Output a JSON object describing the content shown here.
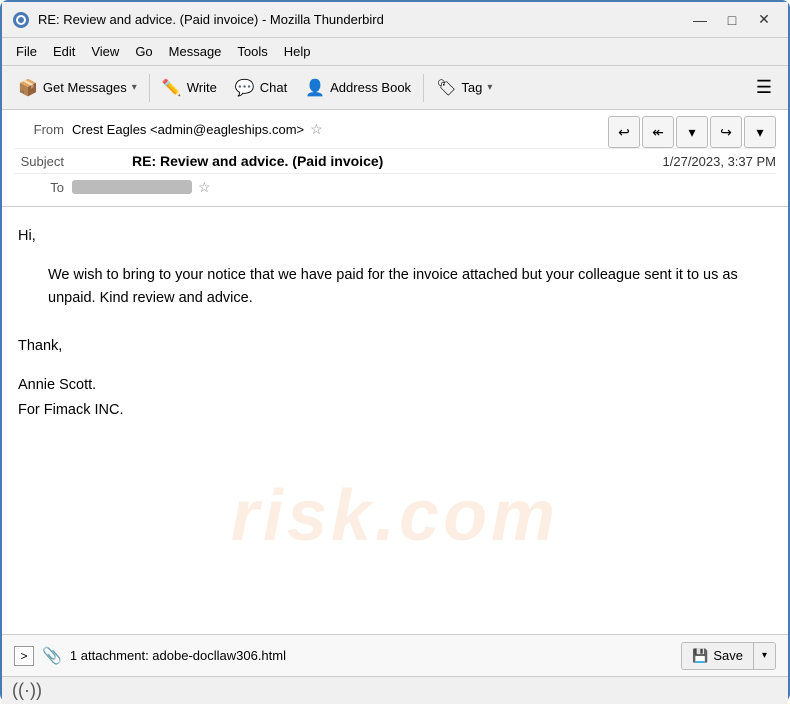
{
  "titleBar": {
    "title": "RE: Review and advice. (Paid invoice) - Mozilla Thunderbird",
    "iconColor": "#4a7ab5",
    "minimizeBtn": "—",
    "maximizeBtn": "□",
    "closeBtn": "✕"
  },
  "menuBar": {
    "items": [
      "File",
      "Edit",
      "View",
      "Go",
      "Message",
      "Tools",
      "Help"
    ]
  },
  "toolbar": {
    "getMessages": "Get Messages",
    "write": "Write",
    "chat": "Chat",
    "addressBook": "Address Book",
    "tag": "Tag"
  },
  "emailHeader": {
    "fromLabel": "From",
    "fromValue": "Crest Eagles <admin@eagleships.com>",
    "subjectLabel": "Subject",
    "subjectValue": "RE: Review and advice. (Paid invoice)",
    "date": "1/27/2023, 3:37 PM",
    "toLabel": "To"
  },
  "emailBody": {
    "greeting": "Hi,",
    "paragraph": "We wish to bring to your notice that we have paid for the invoice attached but your colleague sent it to us as unpaid. Kind review and advice.",
    "closing": "Thank,",
    "signature1": "Annie Scott.",
    "signature2": "For Fimack INC."
  },
  "attachment": {
    "expandBtn": ">",
    "count": "1 attachment: adobe-docllaw306.html",
    "saveBtn": "Save"
  },
  "statusBar": {
    "icon": "((·))"
  },
  "watermark": "risk.com"
}
